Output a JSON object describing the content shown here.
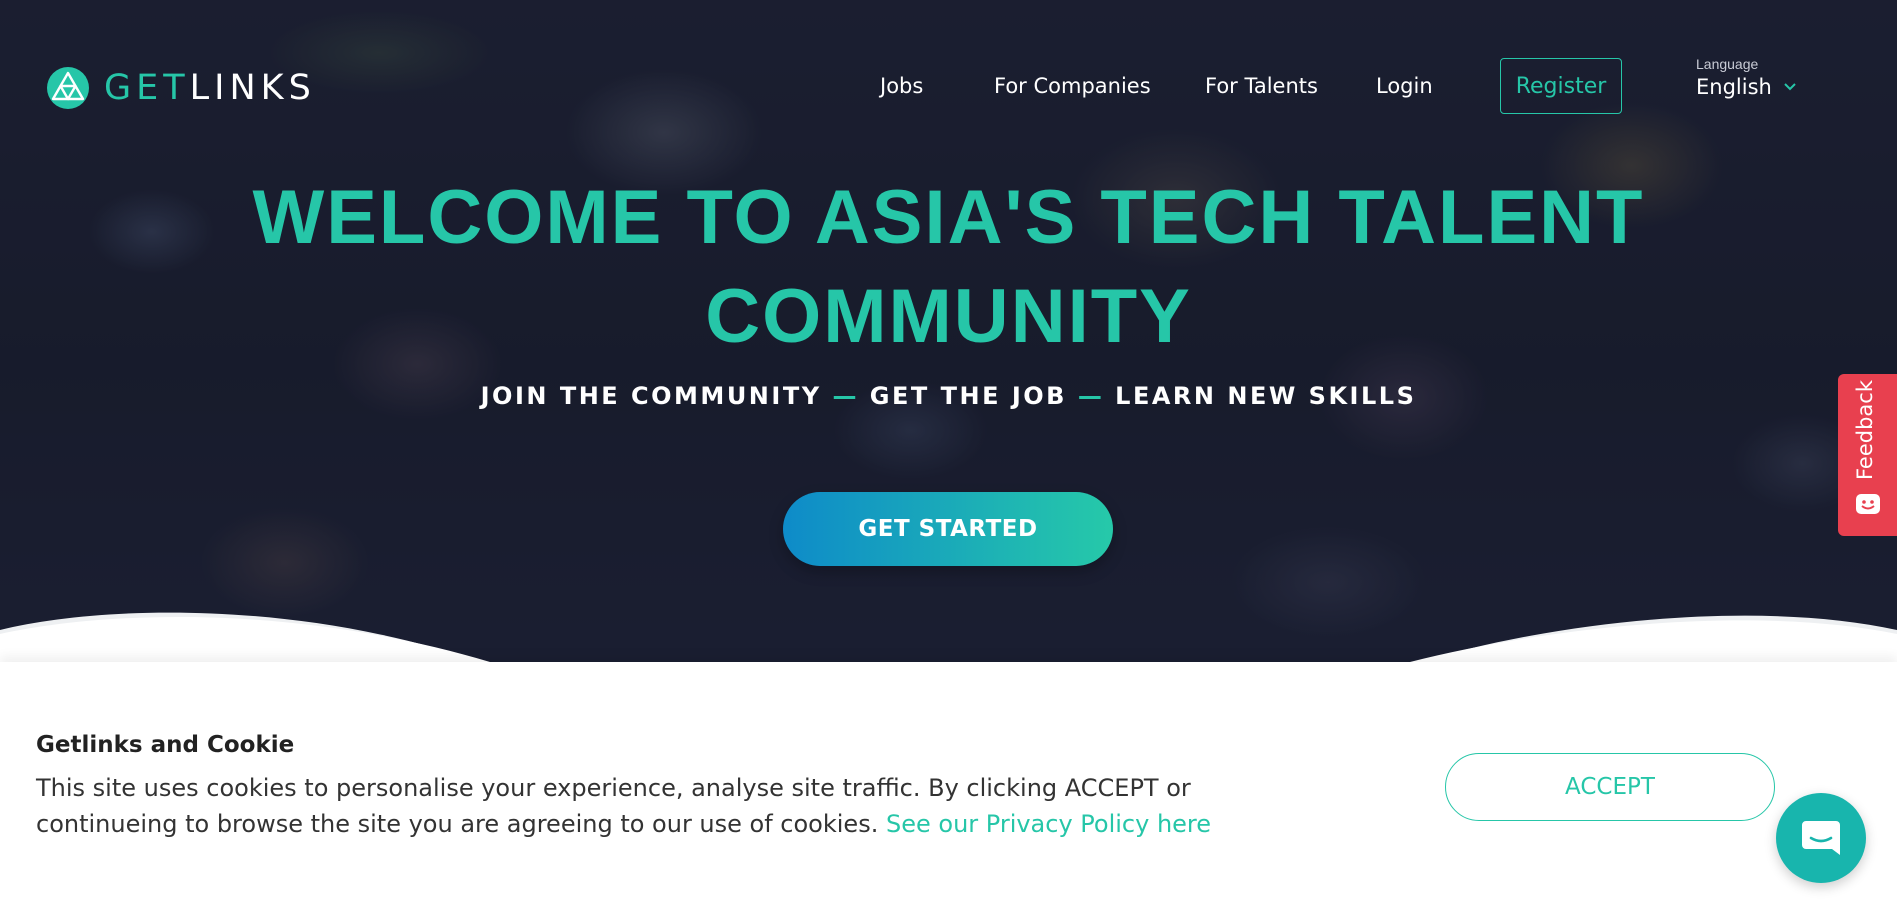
{
  "brand": {
    "logo_prefix": "GET",
    "logo_suffix": "LINKS",
    "accent_color": "#26c6a8",
    "logo_icon": "getlinks-triangle-logo-icon"
  },
  "nav": {
    "items": [
      {
        "label": "Jobs"
      },
      {
        "label": "For Companies"
      },
      {
        "label": "For Talents"
      },
      {
        "label": "Login"
      }
    ],
    "register_label": "Register",
    "language_label": "Language",
    "language_value": "English",
    "language_icon": "chevron-down-icon"
  },
  "hero": {
    "title_line1": "WELCOME TO ASIA'S TECH TALENT",
    "title_line2": "COMMUNITY",
    "subtitle_part1": "JOIN THE COMMUNITY",
    "subtitle_part2": "GET THE JOB",
    "subtitle_part3": "LEARN NEW SKILLS",
    "separator": "—",
    "cta_label": "GET STARTED",
    "cta_gradient": [
      "#0e8bc9",
      "#26c9a9"
    ]
  },
  "feedback": {
    "label": "Feedback",
    "color": "#e8404f",
    "icon": "smiley-face-icon"
  },
  "cookie": {
    "title": "Getlinks and Cookie",
    "body": "This site uses cookies to personalise your experience, analyse site traffic. By clicking ACCEPT or continueing to browse the site you are agreeing to our use of cookies.",
    "link_text": "See our Privacy Policy here",
    "accept_label": "ACCEPT"
  },
  "chat": {
    "icon": "chat-bubble-icon",
    "color": "#18b5ad"
  }
}
